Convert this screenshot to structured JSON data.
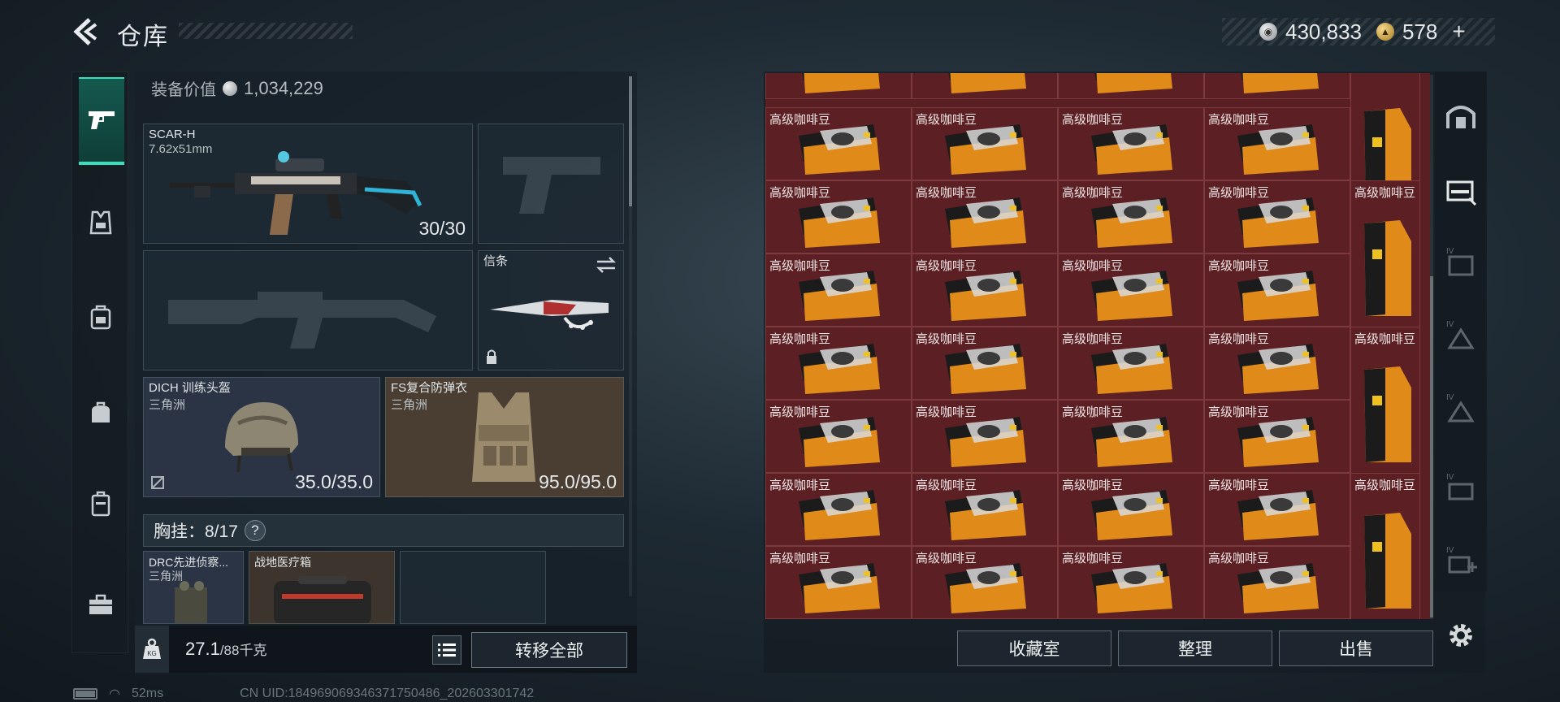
{
  "header": {
    "title": "仓库"
  },
  "currency": {
    "silver": "430,833",
    "gold": "578",
    "add": "+"
  },
  "loadout": {
    "equip_value_label": "装备价值",
    "equip_value": "1,034,229",
    "primary": {
      "name": "SCAR-H",
      "caliber": "7.62x51mm",
      "ammo": "30/30"
    },
    "melee": {
      "name": "信条"
    },
    "helmet": {
      "name": "DICH 训练头盔",
      "sub": "三角洲",
      "durability": "35.0/35.0"
    },
    "armor": {
      "name": "FS复合防弹衣",
      "sub": "三角洲",
      "durability": "95.0/95.0"
    },
    "chest_rig": {
      "label": "胸挂：8/17",
      "help": "?"
    },
    "rig_items": [
      {
        "name": "DRC先进侦察...",
        "sub": "三角洲"
      },
      {
        "name": "战地医疗箱",
        "sub": ""
      }
    ]
  },
  "weight": {
    "kg_label": "KG",
    "value": "27.1",
    "max": "/88千克"
  },
  "buttons": {
    "transfer_all": "转移全部",
    "collection": "收藏室",
    "organize": "整理",
    "sell": "出售"
  },
  "storage": {
    "item_label": "高级咖啡豆"
  },
  "status": {
    "ping": "52ms",
    "uid": "CN UID:184969069346371750486_202603301742"
  },
  "colors": {
    "accent": "#35e0bf",
    "storage_cell": "#5c2024"
  },
  "icons": {
    "left_nav": [
      "pistol-icon",
      "vest-icon",
      "backpack-icon",
      "bag-icon",
      "case-icon",
      "toolbox-icon"
    ],
    "right_nav": [
      "shelter-icon",
      "gun-storage-icon",
      "storage-iv-icon",
      "storage-iv-icon",
      "storage-iv-icon",
      "storage-iv-icon",
      "storage-iv-add-icon"
    ]
  }
}
